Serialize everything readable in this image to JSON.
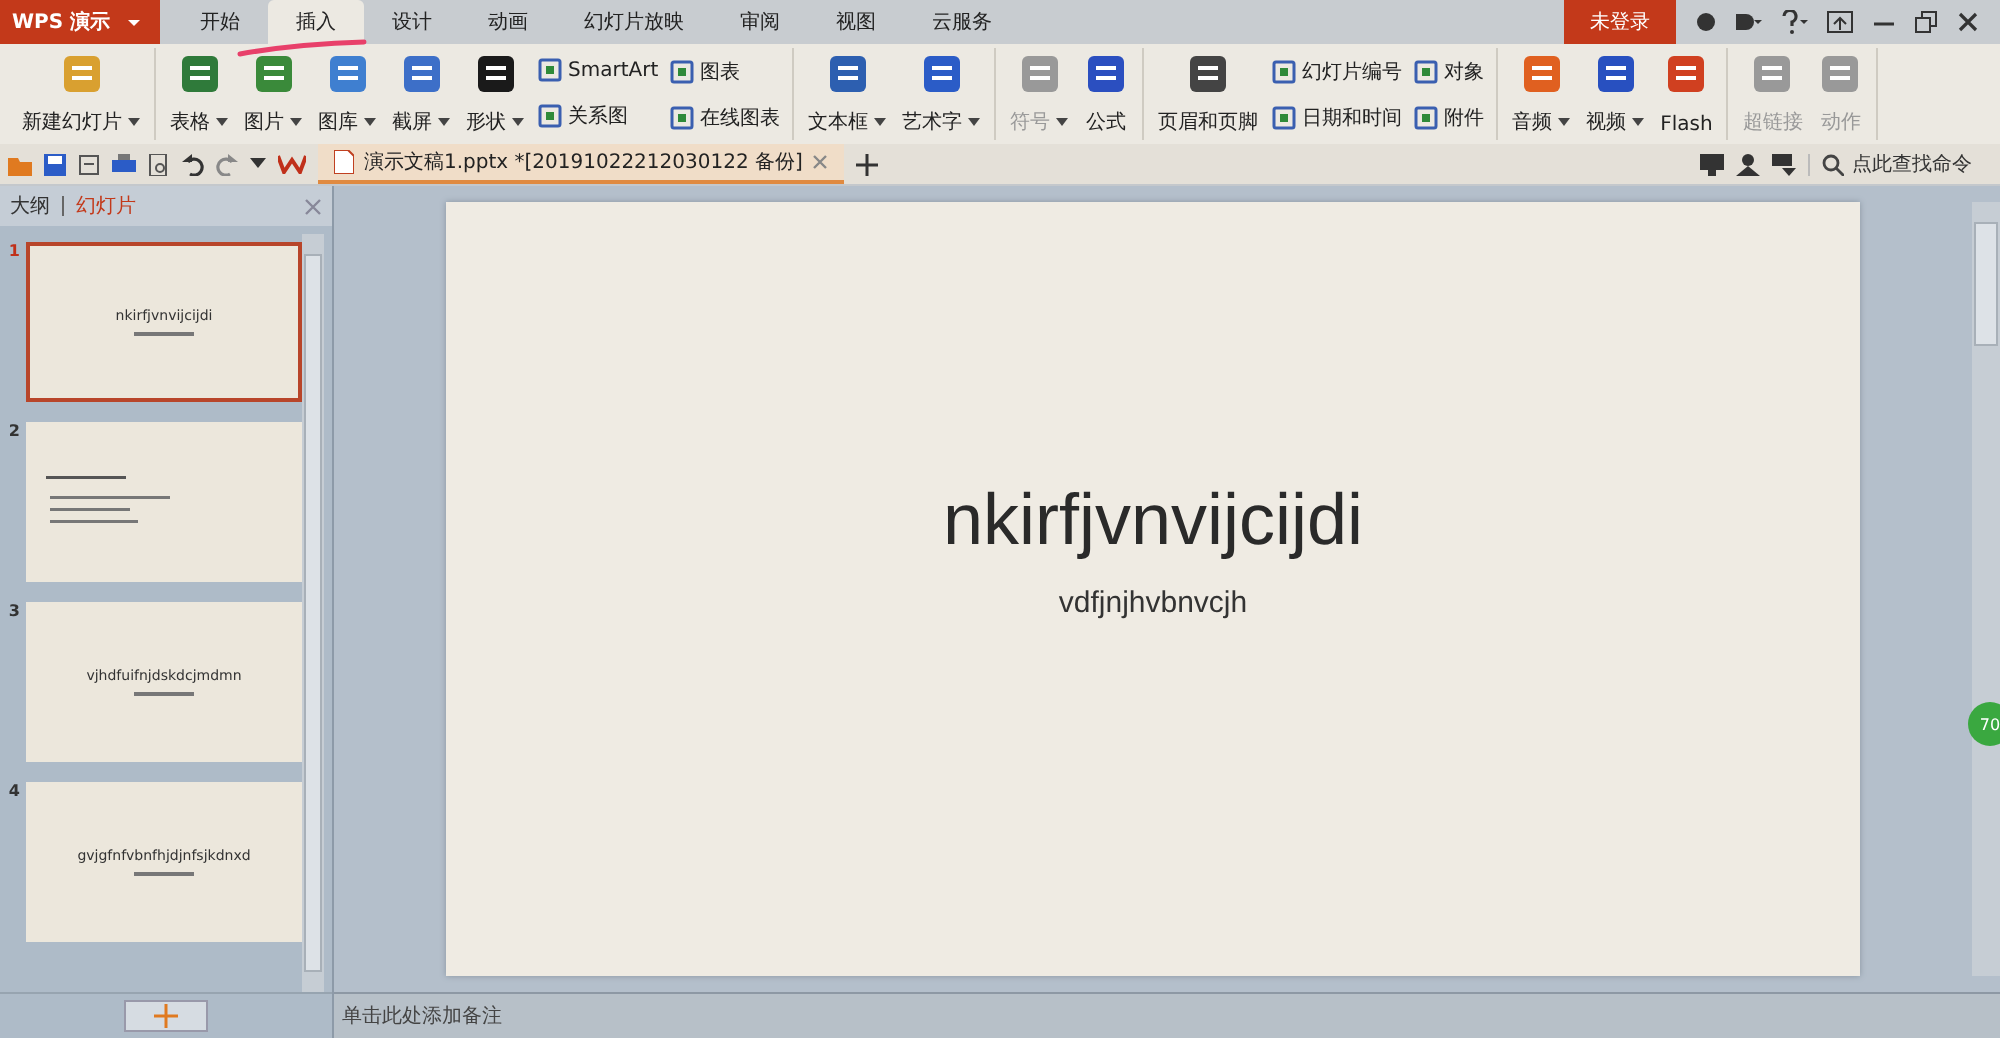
{
  "app_menu": {
    "label": "WPS 演示"
  },
  "tabs": [
    {
      "label": "开始",
      "selected": false
    },
    {
      "label": "插入",
      "selected": true
    },
    {
      "label": "设计",
      "selected": false
    },
    {
      "label": "动画",
      "selected": false
    },
    {
      "label": "幻灯片放映",
      "selected": false
    },
    {
      "label": "审阅",
      "selected": false
    },
    {
      "label": "视图",
      "selected": false
    },
    {
      "label": "云服务",
      "selected": false
    }
  ],
  "login": {
    "label": "未登录"
  },
  "ribbon": [
    {
      "items": [
        {
          "kind": "large",
          "label": "新建幻灯片",
          "dropdown": true,
          "disabled": false
        }
      ]
    },
    {
      "items": [
        {
          "kind": "large",
          "label": "表格",
          "dropdown": true,
          "disabled": false
        },
        {
          "kind": "large",
          "label": "图片",
          "dropdown": true,
          "disabled": false
        },
        {
          "kind": "large",
          "label": "图库",
          "dropdown": true,
          "disabled": false
        },
        {
          "kind": "large",
          "label": "截屏",
          "dropdown": true,
          "disabled": false
        },
        {
          "kind": "large",
          "label": "形状",
          "dropdown": true,
          "disabled": false
        },
        {
          "kind": "pair",
          "items": [
            {
              "label": "SmartArt"
            },
            {
              "label": "关系图"
            }
          ]
        },
        {
          "kind": "pair",
          "items": [
            {
              "label": "图表"
            },
            {
              "label": "在线图表"
            }
          ]
        }
      ]
    },
    {
      "items": [
        {
          "kind": "large",
          "label": "文本框",
          "dropdown": true,
          "disabled": false
        },
        {
          "kind": "large",
          "label": "艺术字",
          "dropdown": true,
          "disabled": false
        }
      ]
    },
    {
      "items": [
        {
          "kind": "large",
          "label": "符号",
          "dropdown": true,
          "disabled": true
        },
        {
          "kind": "large",
          "label": "公式",
          "dropdown": false,
          "disabled": false
        }
      ]
    },
    {
      "items": [
        {
          "kind": "large",
          "label": "页眉和页脚",
          "dropdown": false,
          "disabled": false
        },
        {
          "kind": "pair",
          "items": [
            {
              "label": "幻灯片编号"
            },
            {
              "label": "日期和时间"
            }
          ]
        },
        {
          "kind": "pair",
          "items": [
            {
              "label": "对象"
            },
            {
              "label": "附件"
            }
          ]
        }
      ]
    },
    {
      "items": [
        {
          "kind": "large",
          "label": "音频",
          "dropdown": true,
          "disabled": false
        },
        {
          "kind": "large",
          "label": "视频",
          "dropdown": true,
          "disabled": false
        },
        {
          "kind": "large",
          "label": "Flash",
          "dropdown": false,
          "disabled": false
        }
      ]
    },
    {
      "items": [
        {
          "kind": "large",
          "label": "超链接",
          "dropdown": false,
          "disabled": true
        },
        {
          "kind": "large",
          "label": "动作",
          "dropdown": false,
          "disabled": true
        }
      ]
    }
  ],
  "document_tab": {
    "title": "演示文稿1.pptx *[20191022212030122 备份]"
  },
  "command_search": {
    "placeholder": "点此查找命令"
  },
  "panel_tabs": [
    {
      "label": "大纲",
      "selected": false
    },
    {
      "label": "幻灯片",
      "selected": true
    }
  ],
  "slides": [
    {
      "number": "1",
      "selected": true,
      "kind": "title",
      "title": "nkirfjvnvijcijdi"
    },
    {
      "number": "2",
      "selected": false,
      "kind": "bullets"
    },
    {
      "number": "3",
      "selected": false,
      "kind": "title",
      "title": "vjhdfuifnjdskdcjmdmn"
    },
    {
      "number": "4",
      "selected": false,
      "kind": "title",
      "title": "gvjgfnfvbnfhjdjnfsjkdnxd"
    }
  ],
  "slide": {
    "title": "nkirfjvnvijcijdi",
    "subtitle": "vdfjnjhvbnvcjh"
  },
  "side_widget": {
    "label": "70"
  },
  "notes": {
    "placeholder": "单击此处添加备注"
  }
}
